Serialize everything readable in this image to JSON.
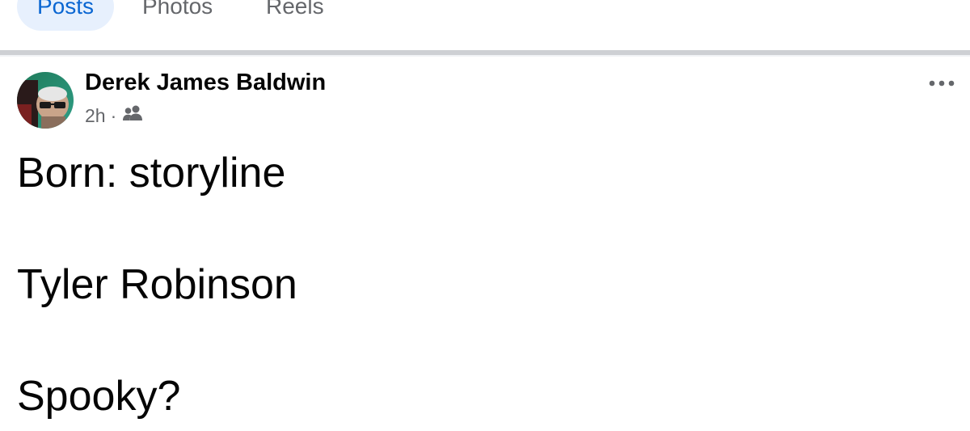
{
  "tabs": [
    {
      "label": "Posts",
      "active": true
    },
    {
      "label": "Photos",
      "active": false
    },
    {
      "label": "Reels",
      "active": false
    }
  ],
  "post": {
    "author": "Derek James Baldwin",
    "time": "2h",
    "separator": "·",
    "audience_icon": "friends-icon",
    "more_icon": "more-options-icon",
    "lines": [
      "Born: storyline",
      "Tyler Robinson",
      "Spooky?"
    ]
  },
  "colors": {
    "accent": "#0a66d2",
    "active_tab_bg": "#e7f0fd",
    "secondary_text": "#65676b",
    "divider": "#ced0d4"
  }
}
